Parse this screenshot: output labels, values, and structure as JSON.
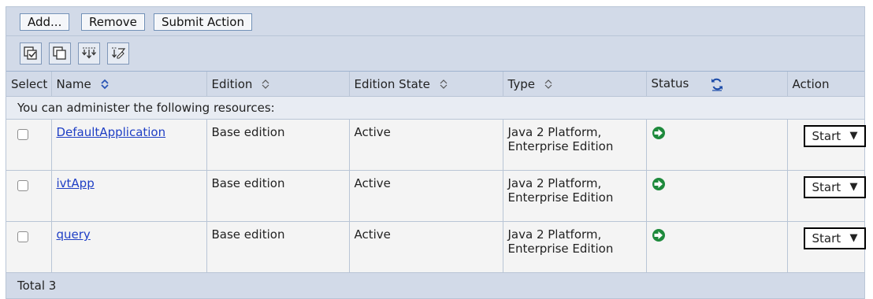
{
  "toolbar": {
    "add_label": "Add...",
    "remove_label": "Remove",
    "submit_label": "Submit Action"
  },
  "icon_toolbar": [
    "select-all-icon",
    "deselect-all-icon",
    "expand-all-icon",
    "show-filter-icon"
  ],
  "columns": {
    "select": "Select",
    "name": "Name",
    "edition": "Edition",
    "edition_state": "Edition State",
    "type": "Type",
    "status": "Status",
    "action": "Action"
  },
  "message": "You can administer the following resources:",
  "rows": [
    {
      "name": "DefaultApplication",
      "edition": "Base edition",
      "state": "Active",
      "type_line1": "Java 2 Platform,",
      "type_line2": "Enterprise Edition",
      "status": "started-arrow-icon",
      "action": "Start"
    },
    {
      "name": "ivtApp",
      "edition": "Base edition",
      "state": "Active",
      "type_line1": "Java 2 Platform,",
      "type_line2": "Enterprise Edition",
      "status": "started-arrow-icon",
      "action": "Start"
    },
    {
      "name": "query",
      "edition": "Base edition",
      "state": "Active",
      "type_line1": "Java 2 Platform,",
      "type_line2": "Enterprise Edition",
      "status": "started-arrow-icon",
      "action": "Start"
    }
  ],
  "footer": {
    "total": "Total 3"
  },
  "colors": {
    "header_bg": "#d2dae8",
    "link": "#1f3fc5",
    "status_green": "#1e8a3c"
  }
}
